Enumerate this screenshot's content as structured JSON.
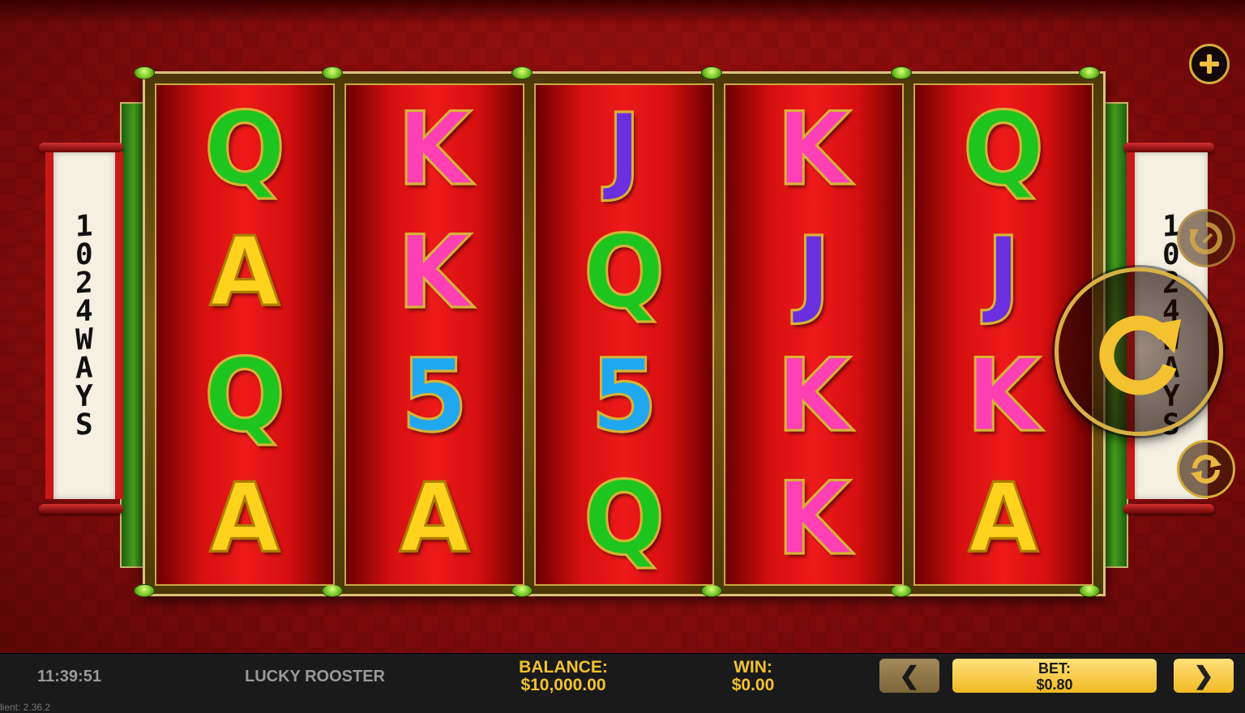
{
  "side_scroll": {
    "chars": [
      "1",
      "0",
      "2",
      "4",
      "W",
      "A",
      "Y",
      "S"
    ]
  },
  "reels": [
    [
      "Q",
      "A",
      "Q",
      "A"
    ],
    [
      "K",
      "K",
      "5",
      "A"
    ],
    [
      "J",
      "Q",
      "5",
      "Q"
    ],
    [
      "K",
      "J",
      "K",
      "K"
    ],
    [
      "Q",
      "J",
      "K",
      "A"
    ]
  ],
  "controls": {
    "plus_icon": "plus-icon",
    "autoplay_icon": "autoplay-icon",
    "spin_icon": "spin-arrow-icon",
    "quickspin_icon": "refresh-icon"
  },
  "bottom_bar": {
    "clock": "11:39:51",
    "game_title": "LUCKY ROOSTER",
    "balance_label": "BALANCE:",
    "balance_value": "$10,000.00",
    "win_label": "WIN:",
    "win_value": "$0.00",
    "bet_label": "BET:",
    "bet_value": "$0.80",
    "bet_down": "❮",
    "bet_up": "❯",
    "version": "lient: 2.36.2"
  },
  "colors": {
    "gold": "#f2c230",
    "symbol_Q": "#1ec51e",
    "symbol_K": "#ff3fb4",
    "symbol_J": "#6b2fe0",
    "symbol_5": "#1fa8f0",
    "symbol_A": "#ffd21e"
  }
}
